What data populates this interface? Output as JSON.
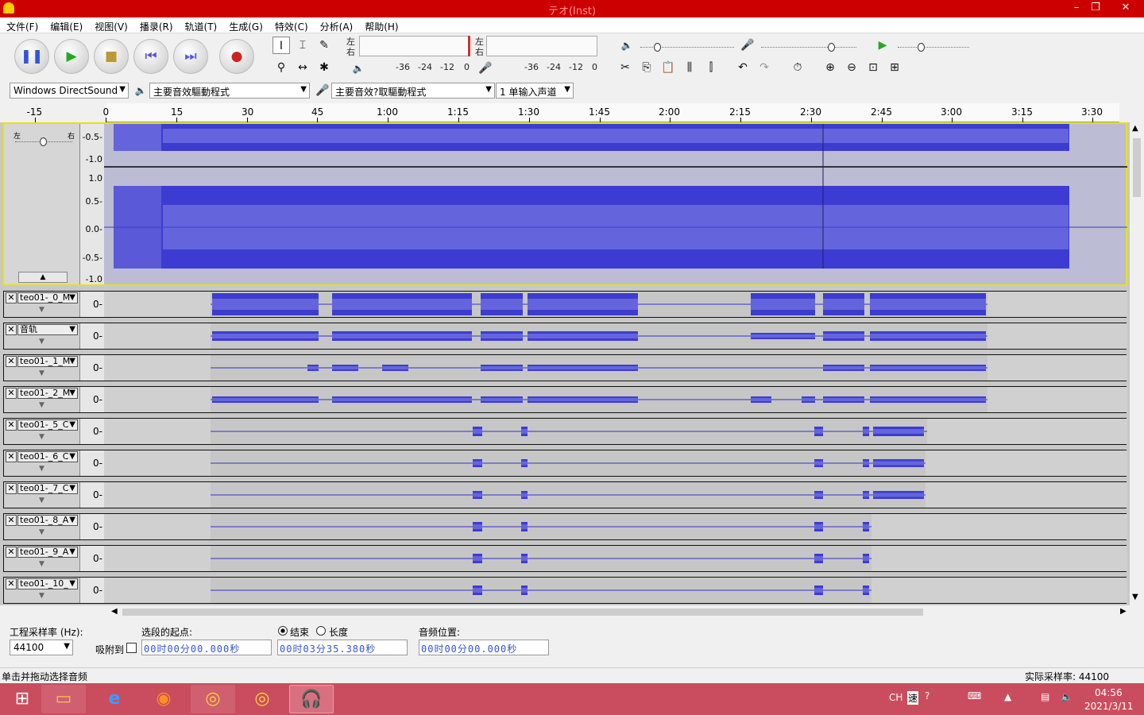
{
  "window": {
    "title": "テオ(Inst)"
  },
  "menu": [
    "文件(F)",
    "编辑(E)",
    "视图(V)",
    "播录(R)",
    "轨道(T)",
    "生成(G)",
    "特效(C)",
    "分析(A)",
    "帮助(H)"
  ],
  "meter": {
    "left_label": "左",
    "right_label": "右",
    "play_ticks": [
      "-36",
      "-24",
      "-12",
      "0"
    ],
    "rec_ticks": [
      "-36",
      "-24",
      "-12",
      "0"
    ]
  },
  "devices": {
    "host": "Windows DirectSound",
    "output": "主要音效驅動程式",
    "input": "主要音效?取驅動程式",
    "channels": "1 单输入声道"
  },
  "ruler": [
    "-15",
    "0",
    "15",
    "30",
    "45",
    "1:00",
    "1:15",
    "1:30",
    "1:45",
    "2:00",
    "2:15",
    "2:30",
    "2:45",
    "3:00",
    "3:15",
    "3:30"
  ],
  "main_track": {
    "pan_left": "左",
    "pan_right": "右",
    "upper_scale": [
      "-0.5-",
      "-1.0"
    ],
    "lower_scale": [
      "1.0",
      "0.5-",
      "0.0-",
      "-0.5-",
      "-1.0"
    ]
  },
  "tracks": [
    {
      "name": "teo01-_0_M",
      "scale": "0-"
    },
    {
      "name": "音轨",
      "scale": "0-"
    },
    {
      "name": "teo01-_1_M",
      "scale": "0-"
    },
    {
      "name": "teo01-_2_M",
      "scale": "0-"
    },
    {
      "name": "teo01-_5_C",
      "scale": "0-"
    },
    {
      "name": "teo01-_6_C",
      "scale": "0-"
    },
    {
      "name": "teo01-_7_C",
      "scale": "0-"
    },
    {
      "name": "teo01-_8_A",
      "scale": "0-"
    },
    {
      "name": "teo01-_9_A",
      "scale": "0-"
    },
    {
      "name": "teo01-_10_",
      "scale": "0-"
    }
  ],
  "bottom": {
    "rate_label": "工程采样率 (Hz):",
    "rate_value": "44100",
    "snap_label": "吸附到",
    "sel_start_label": "选段的起点:",
    "end_label": "结束",
    "length_label": "长度",
    "audio_pos_label": "音频位置:",
    "sel_start": "00时00分00.000秒",
    "sel_end": "00时03分35.380秒",
    "audio_pos": "00时00分00.000秒"
  },
  "status": {
    "left": "单击并拖动选择音频",
    "right": "实际采样率: 44100"
  },
  "tray": {
    "lang": "CH",
    "ime": "速",
    "time": "04:56",
    "date": "2021/3/11"
  },
  "colors": {
    "title_bg": "#cc0000",
    "wave": "#3232c8",
    "wave_light": "#6464dc",
    "taskbar": "#c94d5e"
  }
}
